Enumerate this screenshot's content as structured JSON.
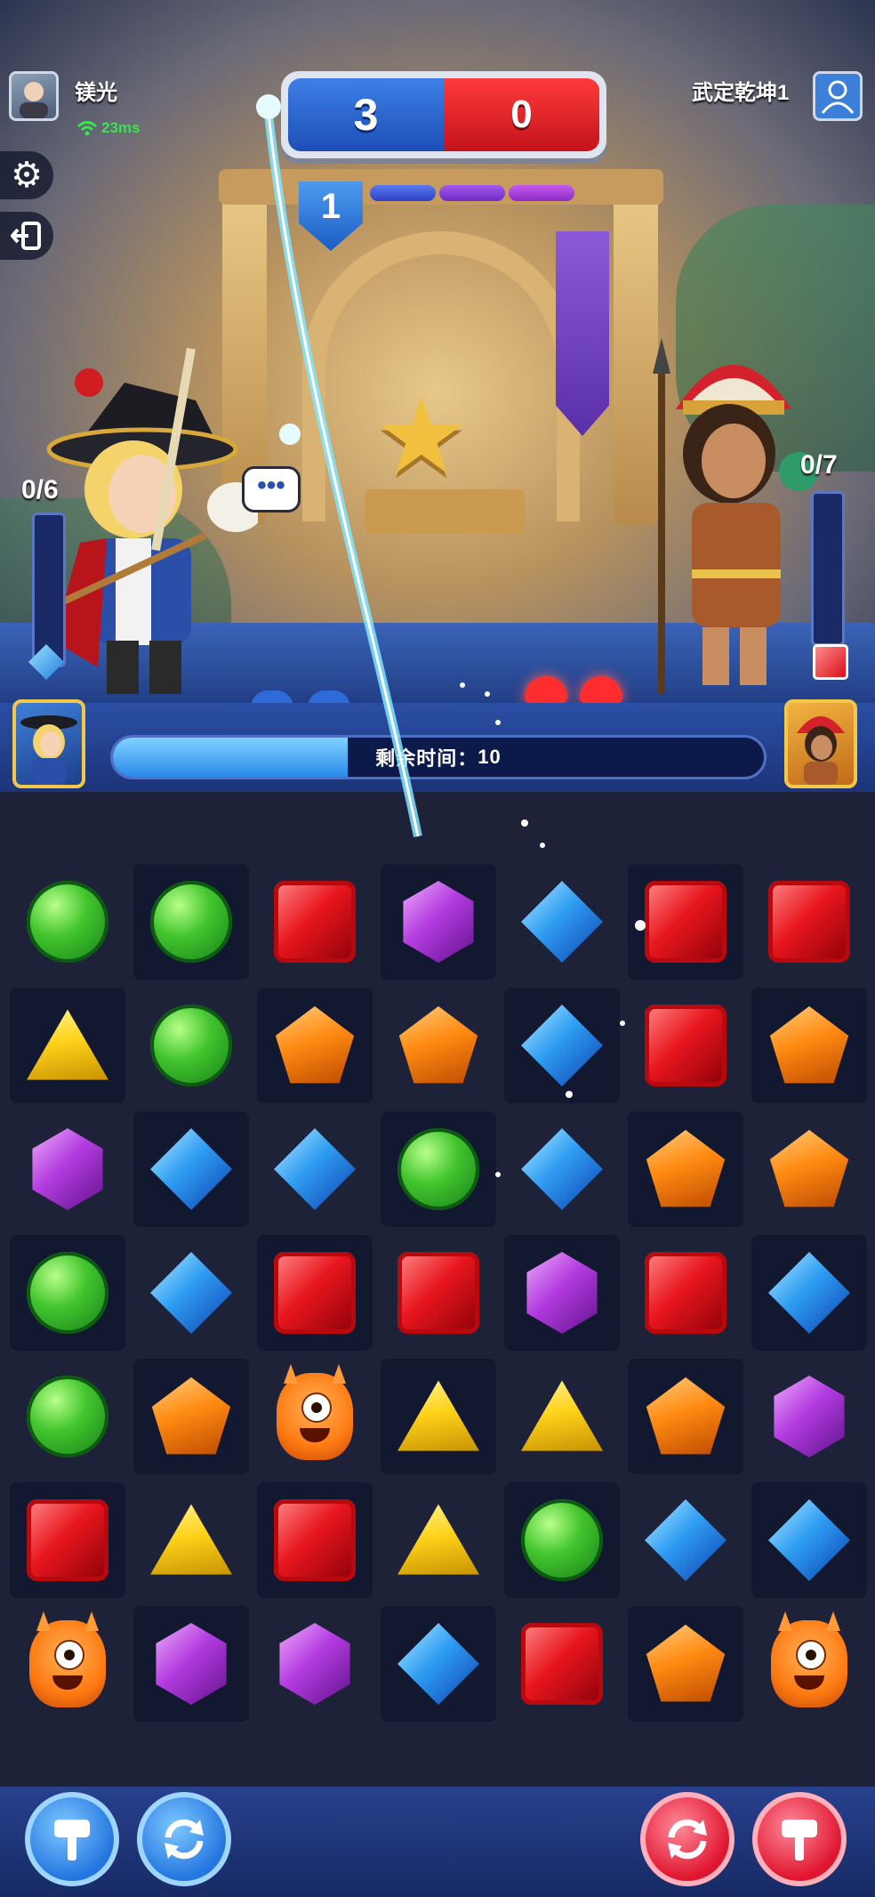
{
  "header": {
    "player_left": {
      "name": "镁光",
      "ping": "23ms"
    },
    "player_right": {
      "name": "武定乾坤1"
    },
    "score": {
      "left": "3",
      "right": "0"
    },
    "round": "1"
  },
  "side_buttons": {
    "settings_icon": "gear-icon",
    "exit_icon": "exit-icon"
  },
  "arena": {
    "left_gauge": "0/6",
    "right_gauge": "0/7",
    "chat_bubble": "•••"
  },
  "timer": {
    "label": "剩余时间：",
    "value": "10",
    "fraction": 0.36
  },
  "board": {
    "rows": [
      [
        "green",
        "green",
        "red",
        "purple",
        "blue",
        "red",
        "red"
      ],
      [
        "yellow",
        "green",
        "orange",
        "orange",
        "blue",
        "red",
        "orange"
      ],
      [
        "purple",
        "blue",
        "blue",
        "green",
        "blue",
        "orange",
        "orange"
      ],
      [
        "green",
        "blue",
        "red",
        "red",
        "purple",
        "red",
        "blue"
      ],
      [
        "green",
        "orange",
        "monster",
        "yellow",
        "yellow",
        "orange",
        "purple"
      ],
      [
        "red",
        "yellow",
        "red",
        "yellow",
        "green",
        "blue",
        "blue"
      ],
      [
        "monster",
        "purple",
        "purple",
        "blue",
        "red",
        "orange",
        "monster"
      ]
    ]
  },
  "powerups": {
    "left": [
      "hammer-icon",
      "shuffle-icon"
    ],
    "right": [
      "shuffle-icon",
      "hammer-icon"
    ]
  },
  "colors": {
    "team_blue": "#2a6fd8",
    "team_red": "#e2131f",
    "board_bg": "#1e2238",
    "timer_fill": "#2a8ae8"
  }
}
